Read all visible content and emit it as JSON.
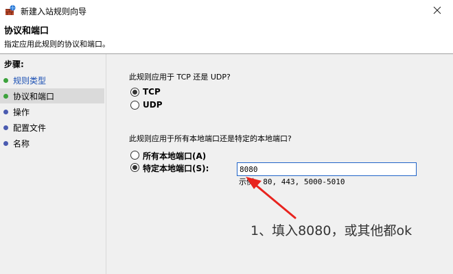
{
  "window": {
    "title": "新建入站规则向导",
    "icon": "firewall-icon"
  },
  "header": {
    "heading": "协议和端口",
    "subtitle": "指定应用此规则的协议和端口。"
  },
  "steps": {
    "title": "步骤:",
    "items": [
      {
        "label": "规则类型",
        "state": "done"
      },
      {
        "label": "协议和端口",
        "state": "current"
      },
      {
        "label": "操作",
        "state": "todo"
      },
      {
        "label": "配置文件",
        "state": "todo"
      },
      {
        "label": "名称",
        "state": "todo"
      }
    ]
  },
  "protocol": {
    "question": "此规则应用于 TCP 还是 UDP?",
    "options": [
      {
        "label": "TCP",
        "checked": true
      },
      {
        "label": "UDP",
        "checked": false
      }
    ]
  },
  "ports": {
    "question": "此规则应用于所有本地端口还是特定的本地端口?",
    "options": [
      {
        "label": "所有本地端口(A)",
        "checked": false
      },
      {
        "label": "特定本地端口(S):",
        "checked": true
      }
    ],
    "value": "8080",
    "example": "示例: 80, 443, 5000-5010"
  },
  "annotation": {
    "text": "1、填入8080，或其他都ok",
    "color": "#e8231e"
  },
  "colors": {
    "step_done": "#3ca23c",
    "step_todo": "#4a5bb0",
    "link": "#1a4fb3",
    "input_border": "#1e63c8"
  }
}
